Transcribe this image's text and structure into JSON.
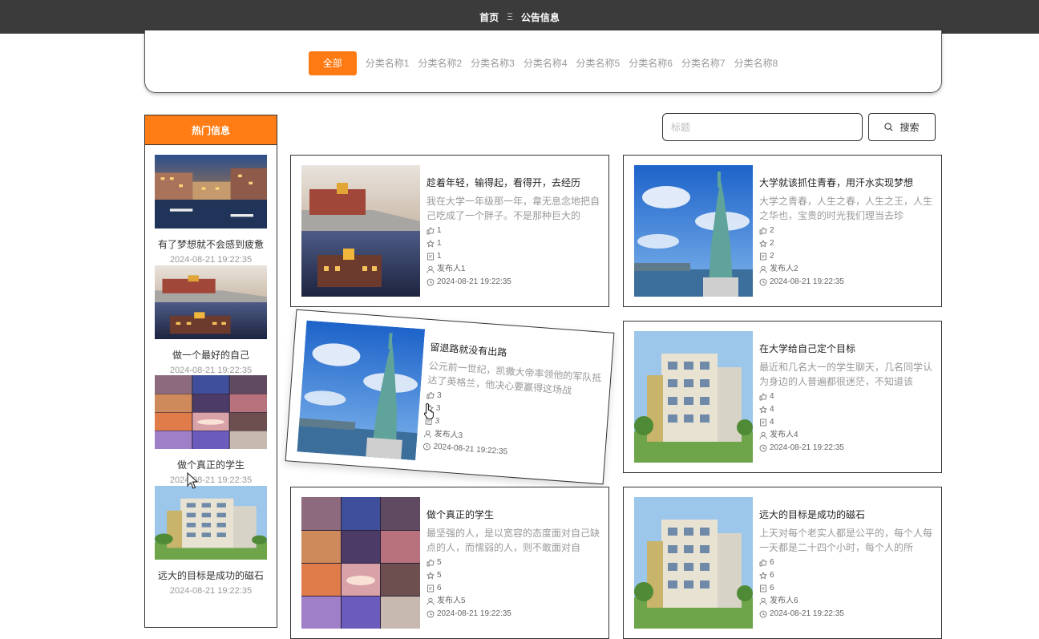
{
  "topbar": {
    "home": "首页",
    "separator": "Ξ",
    "current": "公告信息"
  },
  "categories": {
    "active": "全部",
    "items": [
      "分类名称1",
      "分类名称2",
      "分类名称3",
      "分类名称4",
      "分类名称5",
      "分类名称6",
      "分类名称7",
      "分类名称8"
    ]
  },
  "hot": {
    "title": "热门信息",
    "items": [
      {
        "title": "有了梦想就不会感到疲惫",
        "date": "2024-08-21 19:22:35",
        "image": "venice-canal-night"
      },
      {
        "title": "做一个最好的自己",
        "date": "2024-08-21 19:22:35",
        "image": "street-building-dusk"
      },
      {
        "title": "做个真正的学生",
        "date": "2024-08-21 19:22:35",
        "image": "futuristic-collage"
      },
      {
        "title": "远大的目标是成功的磁石",
        "date": "2024-08-21 19:22:35",
        "image": "apartment-building"
      }
    ]
  },
  "search": {
    "placeholder": "标题",
    "button": "搜索"
  },
  "cards": [
    {
      "title": "趁着年轻，输得起，看得开，去经历",
      "desc": "我在大学一年级那一年，韋无息念地把自己吃成了一个胖子。不是那种巨大的",
      "likes": "1",
      "favorites": "1",
      "comments": "1",
      "author": "发布人1",
      "date": "2024-08-21 19:22:35",
      "image": "street-building-dusk"
    },
    {
      "title": "大学就该抓住青春，用汗水实现梦想",
      "desc": "大学之青春，人生之春，人生之王，人生之华也，宝贵的时光我们理当去珍",
      "likes": "2",
      "favorites": "2",
      "comments": "2",
      "author": "发布人2",
      "date": "2024-08-21 19:22:35",
      "image": "statue-of-liberty"
    },
    {
      "title": "留退路就没有出路",
      "desc": "公元前一世纪，凯撒大帝率领他的军队抵达了英格兰，他决心要赢得这场战",
      "likes": "3",
      "favorites": "3",
      "comments": "3",
      "author": "发布人3",
      "date": "2024-08-21 19:22:35",
      "image": "statue-of-liberty"
    },
    {
      "title": "在大学给自己定个目标",
      "desc": "最近和几名大一的学生聊天，几名同学认为身边的人普遍都很迷茫，不知道该",
      "likes": "4",
      "favorites": "4",
      "comments": "4",
      "author": "发布人4",
      "date": "2024-08-21 19:22:35",
      "image": "apartment-building"
    },
    {
      "title": "做个真正的学生",
      "desc": "最坚强的人，是以宽容的态度面对自己缺点的人，而懦弱的人，则不敢面对自",
      "likes": "5",
      "favorites": "5",
      "comments": "6",
      "author": "发布人5",
      "date": "2024-08-21 19:22:35",
      "image": "futuristic-collage"
    },
    {
      "title": "远大的目标是成功的磁石",
      "desc": "上天对每个老实人都是公平的，每个人每一天都是二十四个小时，每个人的所",
      "likes": "6",
      "favorites": "6",
      "comments": "6",
      "author": "发布人6",
      "date": "2024-08-21 19:22:35",
      "image": "apartment-building"
    }
  ],
  "colors": {
    "accent": "#ff7a12",
    "topbar": "#3b3b3b"
  }
}
